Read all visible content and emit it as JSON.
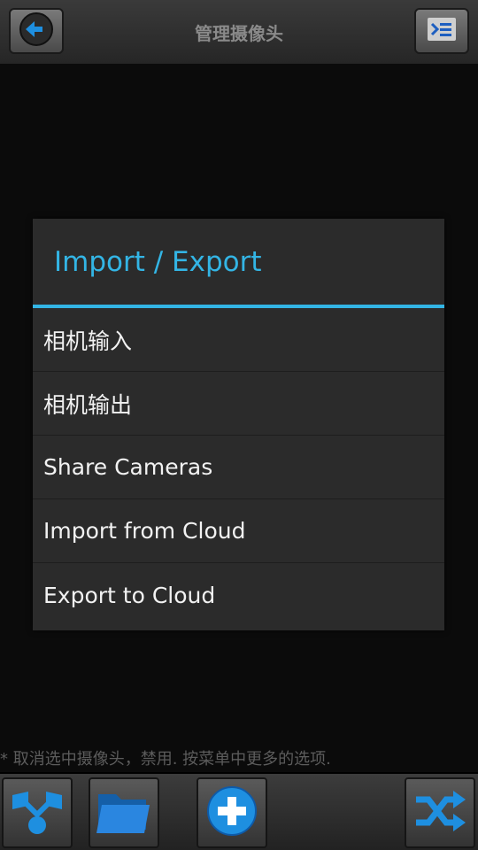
{
  "header": {
    "title": "管理摄像头",
    "back_icon": "arrow-left-icon",
    "menu_icon": "collapse-list-icon"
  },
  "dialog": {
    "title": "Import / Export",
    "items": [
      {
        "label": "相机输入"
      },
      {
        "label": "相机输出"
      },
      {
        "label": "Share Cameras"
      },
      {
        "label": "Import from Cloud"
      },
      {
        "label": "Export to Cloud"
      }
    ]
  },
  "hint": "* 取消选中摄像头，禁用. 按菜单中更多的选项.",
  "bottom_bar": {
    "buttons": [
      {
        "icon": "camera-group-icon"
      },
      {
        "icon": "folder-icon"
      },
      {
        "icon": "add-circle-icon"
      },
      {
        "icon": "shuffle-icon"
      }
    ]
  },
  "colors": {
    "accent": "#33b5e5",
    "icon_blue": "#1e8fe0"
  }
}
